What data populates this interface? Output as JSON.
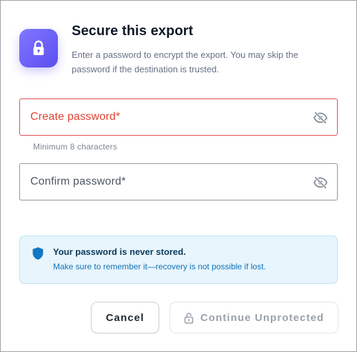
{
  "dialog": {
    "title": "Secure this export",
    "subtitle": "Enter a password to encrypt the export. You may skip the password if the destination is trusted.",
    "icon": "lock-icon",
    "accent_color": "#5b4ef0"
  },
  "fields": {
    "create": {
      "label": "Create password*",
      "value": "",
      "helper": "Minimum 8 characters",
      "toggle_icon": "eye-off-icon",
      "state": "error",
      "state_color": "#e5484d"
    },
    "confirm": {
      "label": "Confirm password*",
      "value": "",
      "toggle_icon": "eye-off-icon"
    }
  },
  "notice": {
    "icon": "shield-icon",
    "title": "Your password is never stored.",
    "body": "Make sure to remember it—recovery is not possible if lost."
  },
  "actions": {
    "cancel_label": "Cancel",
    "continue_label": "Continue Unprotected",
    "continue_icon": "unlock-icon"
  }
}
